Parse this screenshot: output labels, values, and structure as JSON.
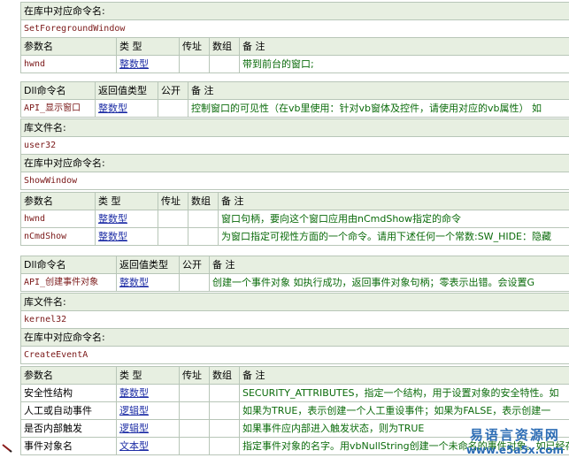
{
  "block1": {
    "lib_cmd_label": "在库中对应命令名:",
    "lib_cmd_value": "SetForegroundWindow",
    "headers": [
      "参数名",
      "类 型",
      "传址",
      "数组",
      "备 注"
    ],
    "params": [
      {
        "name": "hwnd",
        "type": "整数型",
        "byref": "",
        "array": "",
        "note": "带到前台的窗口;"
      }
    ]
  },
  "block2": {
    "headers": [
      "Dll命令名",
      "返回值类型",
      "公开",
      "备 注"
    ],
    "row": {
      "name": "API_显示窗口",
      "ret": "整数型",
      "public": "",
      "note": "控制窗口的可见性（在vb里使用：针对vb窗体及控件，请使用对应的vb属性）  如"
    },
    "lib_file_label": "库文件名:",
    "lib_file_value": "user32",
    "lib_cmd_label": "在库中对应命令名:",
    "lib_cmd_value": "ShowWindow",
    "param_headers": [
      "参数名",
      "类 型",
      "传址",
      "数组",
      "备 注"
    ],
    "params": [
      {
        "name": "hwnd",
        "type": "整数型",
        "byref": "",
        "array": "",
        "note": "窗口句柄，要向这个窗口应用由nCmdShow指定的命令"
      },
      {
        "name": "nCmdShow",
        "type": "整数型",
        "byref": "",
        "array": "",
        "note": "为窗口指定可视性方面的一个命令。请用下述任何一个常数:SW_HIDE：隐藏"
      }
    ]
  },
  "block3": {
    "headers": [
      "Dll命令名",
      "返回值类型",
      "公开",
      "备 注"
    ],
    "row": {
      "name": "API_创建事件对象",
      "ret": "整数型",
      "public": "",
      "note": "创建一个事件对象  如执行成功，返回事件对象句柄；零表示出错。会设置G"
    },
    "lib_file_label": "库文件名:",
    "lib_file_value": "kernel32",
    "lib_cmd_label": "在库中对应命令名:",
    "lib_cmd_value": "CreateEventA",
    "param_headers": [
      "参数名",
      "类 型",
      "传址",
      "数组",
      "备 注"
    ],
    "params": [
      {
        "name": "安全性结构",
        "type": "整数型",
        "byref": "",
        "array": "",
        "note": "SECURITY_ATTRIBUTES，指定一个结构，用于设置对象的安全特性。如"
      },
      {
        "name": "人工或自动事件",
        "type": "逻辑型",
        "byref": "",
        "array": "",
        "note": "如果为TRUE，表示创建一个人工重设事件；如果为FALSE，表示创建一"
      },
      {
        "name": "是否内部触发",
        "type": "逻辑型",
        "byref": "",
        "array": "",
        "note": "如果事件应内部进入触发状态，则为TRUE"
      },
      {
        "name": "事件对象名",
        "type": "文本型",
        "byref": "",
        "array": "",
        "note": "指定事件对象的名字。用vbNullString创建一个未命名的事件对象。如已经存"
      }
    ]
  },
  "watermark": {
    "line1": "易语言资源网",
    "line2": "www.e5a5x.com"
  },
  "colors": {
    "header_bg": "#e7efe1",
    "border": "#b8c6b8",
    "type_link": "#1f2fa6",
    "note_text": "#0b6b0b",
    "code_text": "#7a1818"
  }
}
